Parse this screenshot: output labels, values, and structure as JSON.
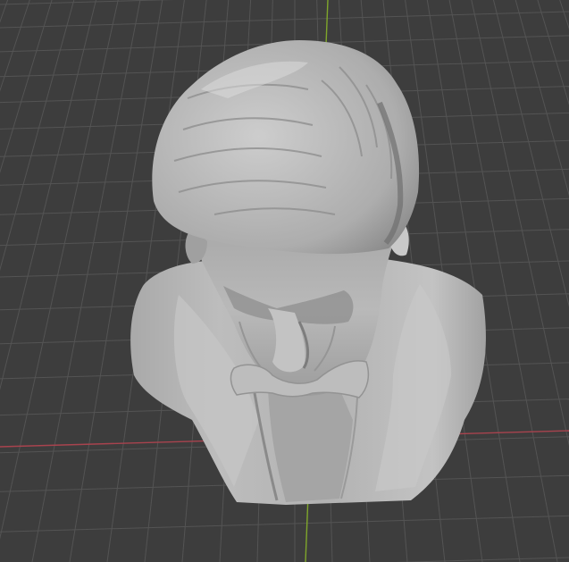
{
  "viewport": {
    "view": "perspective",
    "background_color": "#3d3d3d",
    "grid_color": "#545454",
    "x_axis_color": "#a8434e",
    "y_axis_color": "#7fa62b",
    "object_color": "#b5b5b5",
    "object": "sculpted-bust",
    "grid_visible": true
  }
}
